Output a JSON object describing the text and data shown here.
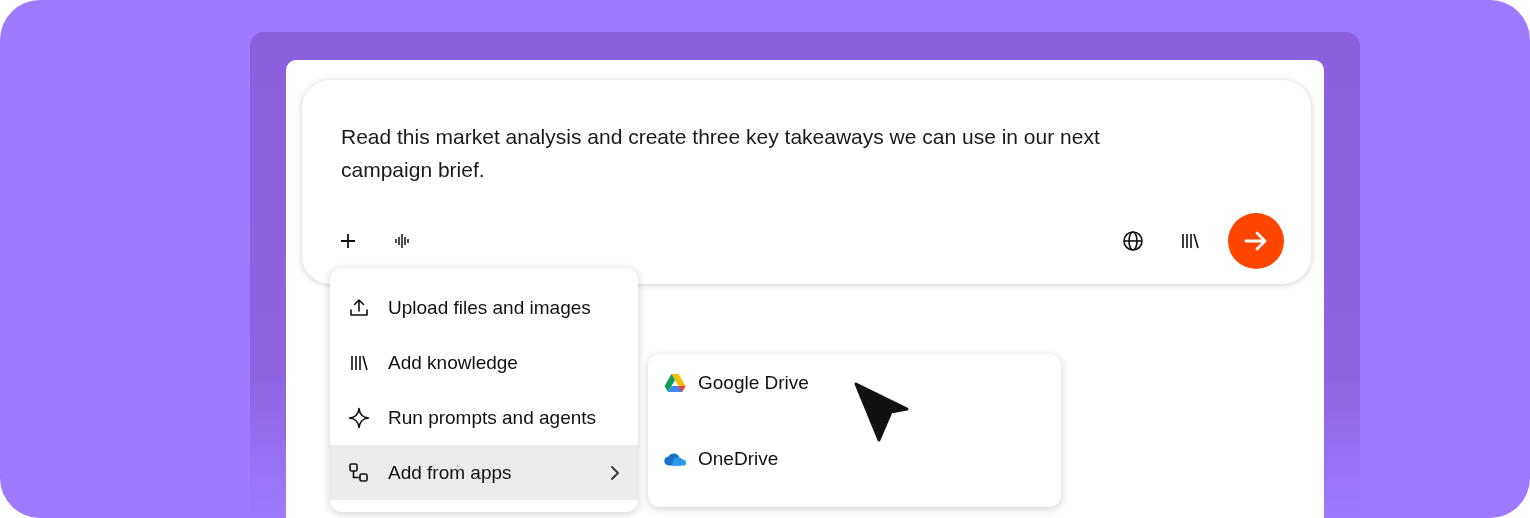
{
  "prompt": {
    "value": "Read this market analysis and create three key takeaways we can use in our next campaign brief."
  },
  "menu": {
    "items": [
      {
        "label": "Upload files and images",
        "selected": false,
        "has_submenu": false
      },
      {
        "label": "Add knowledge",
        "selected": false,
        "has_submenu": false
      },
      {
        "label": "Run prompts and agents",
        "selected": false,
        "has_submenu": false
      },
      {
        "label": "Add from apps",
        "selected": true,
        "has_submenu": true
      }
    ]
  },
  "submenu": {
    "items": [
      {
        "label": "Google Drive"
      },
      {
        "label": "OneDrive"
      }
    ]
  }
}
